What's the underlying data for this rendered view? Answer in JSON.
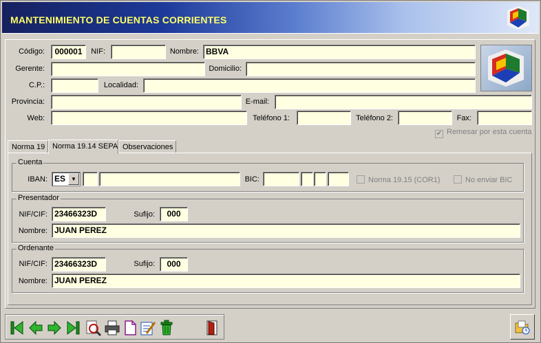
{
  "window": {
    "title": "MANTENIMIENTO DE CUENTAS CORRIENTES"
  },
  "colors": {
    "field_bg": "#ffffe1",
    "title_text": "#ffff66",
    "banner_dark": "#16205e"
  },
  "form": {
    "codigo": {
      "label": "Código:",
      "value": "000001"
    },
    "nif": {
      "label": "NIF:",
      "value": ""
    },
    "nombre": {
      "label": "Nombre:",
      "value": "BBVA"
    },
    "gerente": {
      "label": "Gerente:",
      "value": ""
    },
    "domicilio": {
      "label": "Domicilio:",
      "value": ""
    },
    "cp": {
      "label": "C.P.:",
      "value": ""
    },
    "localidad": {
      "label": "Localidad:",
      "value": ""
    },
    "provincia": {
      "label": "Provincia:",
      "value": ""
    },
    "email": {
      "label": "E-mail:",
      "value": ""
    },
    "web": {
      "label": "Web:",
      "value": ""
    },
    "telefono1": {
      "label": "Teléfono 1:",
      "value": ""
    },
    "telefono2": {
      "label": "Teléfono 2:",
      "value": ""
    },
    "fax": {
      "label": "Fax:",
      "value": ""
    },
    "remesar": {
      "label": "Remesar por esta cuenta",
      "checked": true
    }
  },
  "tabs": [
    {
      "label": "Norma 19"
    },
    {
      "label": "Norma 19.14 SEPA"
    },
    {
      "label": "Observaciones"
    }
  ],
  "cuenta": {
    "group": "Cuenta",
    "iban_label": "IBAN:",
    "iban_country": "ES",
    "bic_label": "BIC:",
    "norma1915": "Norma 19.15 (COR1)",
    "no_enviar_bic": "No enviar BIC"
  },
  "presentador": {
    "group": "Presentador",
    "nif_label": "NIF/CIF:",
    "nif": "23466323D",
    "sufijo_label": "Sufijo:",
    "sufijo": "000",
    "nombre_label": "Nombre:",
    "nombre": "JUAN PEREZ"
  },
  "ordenante": {
    "group": "Ordenante",
    "nif_label": "NIF/CIF:",
    "nif": "23466323D",
    "sufijo_label": "Sufijo:",
    "sufijo": "000",
    "nombre_label": "Nombre:",
    "nombre": "JUAN PEREZ"
  },
  "toolbar": {
    "icons": [
      "first-icon",
      "prev-icon",
      "next-icon",
      "last-icon",
      "search-icon",
      "print-icon",
      "new-icon",
      "edit-icon",
      "delete-icon",
      "exit-icon",
      "open-folder-icon"
    ]
  }
}
